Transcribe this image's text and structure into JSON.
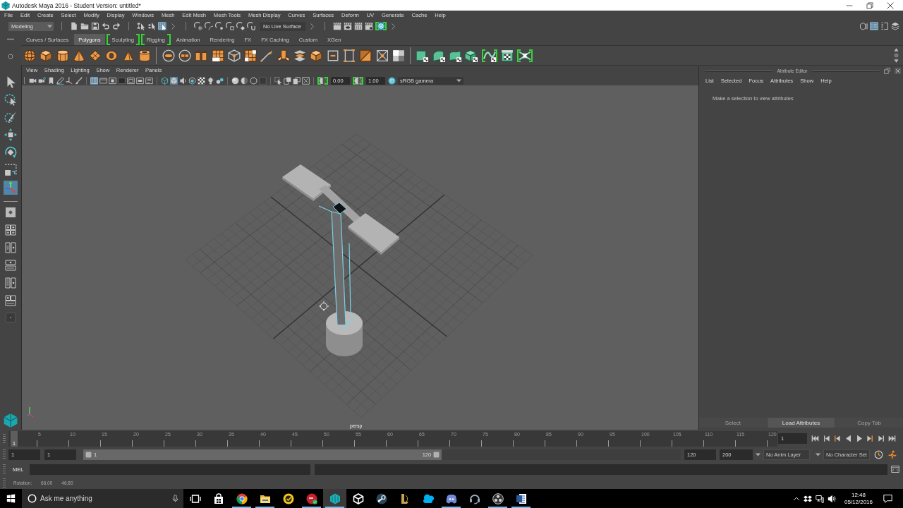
{
  "window": {
    "title": "Autodesk Maya 2016 - Student Version: untitled*"
  },
  "menu_bar": [
    "File",
    "Edit",
    "Create",
    "Select",
    "Modify",
    "Display",
    "Windows",
    "Mesh",
    "Edit Mesh",
    "Mesh Tools",
    "Mesh Display",
    "Curves",
    "Surfaces",
    "Deform",
    "UV",
    "Generate",
    "Cache",
    "Help"
  ],
  "status_line": {
    "workspace": "Modeling",
    "select_modes": [
      {
        "selected": false
      },
      {
        "selected": false
      },
      {
        "selected": true
      }
    ],
    "live_surface": "No Live Surface",
    "render_tools": [
      {
        "highlighted": false
      },
      {
        "highlighted": false
      },
      {
        "highlighted": false
      },
      {
        "highlighted": false
      },
      {
        "highlighted": true
      }
    ],
    "panel_toggles": [
      {
        "on": false
      },
      {
        "on": true
      },
      {
        "on": false
      },
      {
        "on": false
      }
    ]
  },
  "shelf": {
    "tabs": [
      {
        "label": "Curves / Surfaces",
        "selected": false,
        "highlighted": false
      },
      {
        "label": "Polygons",
        "selected": true,
        "highlighted": false
      },
      {
        "label": "Sculpting",
        "selected": false,
        "highlighted": true
      },
      {
        "label": "Rigging",
        "selected": false,
        "highlighted": true
      },
      {
        "label": "Animation",
        "selected": false,
        "highlighted": false
      },
      {
        "label": "Rendering",
        "selected": false,
        "highlighted": false
      },
      {
        "label": "FX",
        "selected": false,
        "highlighted": false
      },
      {
        "label": "FX Caching",
        "selected": false,
        "highlighted": false
      },
      {
        "label": "Custom",
        "selected": false,
        "highlighted": false
      },
      {
        "label": "XGen",
        "selected": false,
        "highlighted": false
      }
    ],
    "buttons": [
      {
        "highlighted": false
      },
      {
        "highlighted": false
      },
      {
        "highlighted": false
      },
      {
        "highlighted": false
      },
      {
        "highlighted": false
      },
      {
        "highlighted": false
      },
      {
        "highlighted": false
      },
      {
        "highlighted": false
      },
      {
        "highlighted": false
      },
      {
        "highlighted": false
      },
      {
        "highlighted": false
      },
      {
        "highlighted": false
      },
      {
        "highlighted": false
      },
      {
        "highlighted": false
      },
      {
        "highlighted": false
      },
      {
        "highlighted": false
      },
      {
        "highlighted": false
      },
      {
        "highlighted": false
      },
      {
        "highlighted": false
      },
      {
        "highlighted": false
      },
      {
        "highlighted": false
      },
      {
        "highlighted": false
      },
      {
        "highlighted": false
      },
      {
        "highlighted": false
      },
      {
        "highlighted": false
      },
      {
        "highlighted": false
      },
      {
        "highlighted": false
      },
      {
        "highlighted": true
      },
      {
        "highlighted": false
      },
      {
        "highlighted": true
      }
    ]
  },
  "toolbox": {
    "tools": [
      {
        "selected": false
      },
      {
        "selected": false
      },
      {
        "selected": false
      },
      {
        "selected": false
      },
      {
        "selected": false
      },
      {
        "selected": false
      },
      {
        "selected": true
      }
    ]
  },
  "viewport": {
    "menu": [
      "View",
      "Shading",
      "Lighting",
      "Show",
      "Renderer",
      "Panels"
    ],
    "toolbar": [
      [
        {
          "on": false
        },
        {
          "on": false
        },
        {
          "on": false
        },
        {
          "on": false
        },
        {
          "on": false
        },
        {
          "on": false
        }
      ],
      [
        {
          "on": true
        },
        {
          "on": false
        },
        {
          "on": false
        },
        {
          "on": false
        },
        {
          "on": false
        },
        {
          "on": false
        },
        {
          "on": false
        }
      ],
      [
        {
          "on": false
        },
        {
          "on": true
        },
        {
          "on": false
        },
        {
          "on": false
        },
        {
          "on": false
        },
        {
          "on": false
        },
        {
          "on": false
        }
      ],
      [
        {
          "on": false
        },
        {
          "on": false
        },
        {
          "on": false
        },
        {
          "on": false
        }
      ],
      [
        {
          "on": false
        },
        {
          "on": false
        },
        {
          "on": false
        },
        {
          "on": false
        }
      ]
    ],
    "exposure": {
      "highlighted": true,
      "value": "0.00"
    },
    "gamma": {
      "highlighted": true,
      "value": "1.00"
    },
    "color_space": "sRGB gamma",
    "camera": "persp"
  },
  "attribute_editor": {
    "title": "Attribute Editor",
    "menu": [
      "List",
      "Selected",
      "Focus",
      "Attributes",
      "Show",
      "Help"
    ],
    "message": "Make a selection to view attributes",
    "buttons": [
      {
        "label": "Select",
        "disabled": true
      },
      {
        "label": "Load Attributes",
        "disabled": false
      },
      {
        "label": "Copy Tab",
        "disabled": true
      }
    ]
  },
  "time_slider": {
    "tick_labels": [
      "5",
      "10",
      "15",
      "20",
      "25",
      "30",
      "35",
      "40",
      "45",
      "50",
      "55",
      "60",
      "65",
      "70",
      "75",
      "80",
      "85",
      "90",
      "95",
      "100",
      "105",
      "110",
      "115",
      "120"
    ],
    "current_frame": "1",
    "level": 0,
    "frame_field": "1"
  },
  "range_slider": {
    "start": "1",
    "playback_start": "1",
    "range_start": "1",
    "range_end": "120",
    "level": 0.6,
    "playback_end": "120",
    "end": "200",
    "anim_layer": "No Anim Layer",
    "character_set": "No Character Set"
  },
  "command_line": {
    "language": "MEL"
  },
  "help_line": {
    "label": "Rotation:",
    "values": [
      "66.00",
      "46.80"
    ]
  },
  "taskbar": {
    "search": {
      "placeholder": "Ask me anything"
    },
    "apps": [
      {
        "running": false,
        "selected": false
      },
      {
        "running": true,
        "selected": false
      },
      {
        "running": true,
        "selected": false
      },
      {
        "running": false,
        "selected": false
      },
      {
        "running": true,
        "selected": false
      },
      {
        "running": true,
        "selected": true
      },
      {
        "running": false,
        "selected": false
      },
      {
        "running": false,
        "selected": false
      },
      {
        "running": false,
        "selected": false
      },
      {
        "running": false,
        "selected": false
      },
      {
        "running": true,
        "selected": false
      },
      {
        "running": false,
        "selected": false
      },
      {
        "running": true,
        "selected": false
      },
      {
        "running": true,
        "selected": false
      }
    ],
    "time": "12:48",
    "date": "05/12/2016"
  }
}
